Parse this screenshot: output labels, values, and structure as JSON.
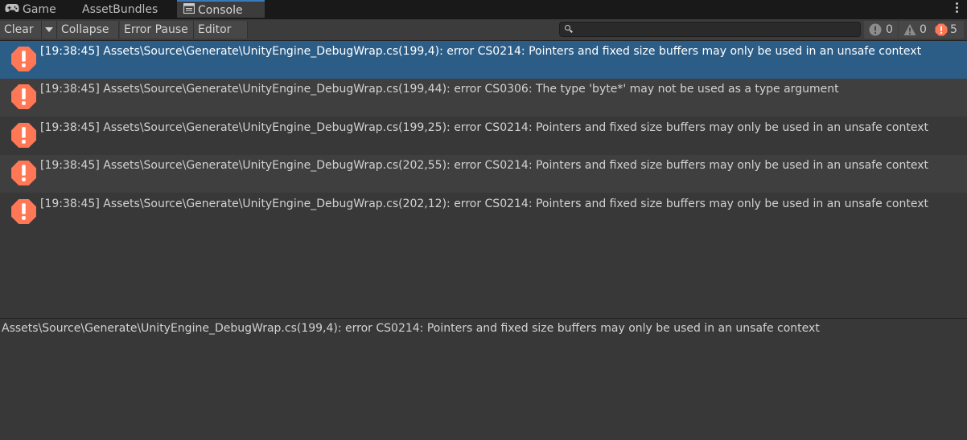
{
  "tabs": [
    {
      "label": "Game",
      "icon": "gamepad-icon"
    },
    {
      "label": "AssetBundles",
      "icon": ""
    },
    {
      "label": "Console",
      "icon": "console-icon"
    }
  ],
  "toolbar": {
    "clear_label": "Clear",
    "collapse_label": "Collapse",
    "error_pause_label": "Error Pause",
    "editor_label": "Editor",
    "search_placeholder": ""
  },
  "counters": {
    "info": "0",
    "warnings": "0",
    "errors": "5"
  },
  "colors": {
    "accent": "#2c5d87",
    "error": "#ff7755",
    "tab_highlight": "#3a79bb"
  },
  "logs": [
    {
      "text": "[19:38:45] Assets\\Source\\Generate\\UnityEngine_DebugWrap.cs(199,4): error CS0214: Pointers and fixed size buffers may only be used in an unsafe context",
      "selected": true
    },
    {
      "text": "[19:38:45] Assets\\Source\\Generate\\UnityEngine_DebugWrap.cs(199,44): error CS0306: The type 'byte*' may not be used as a type argument",
      "selected": false
    },
    {
      "text": "[19:38:45] Assets\\Source\\Generate\\UnityEngine_DebugWrap.cs(199,25): error CS0214: Pointers and fixed size buffers may only be used in an unsafe context",
      "selected": false
    },
    {
      "text": "[19:38:45] Assets\\Source\\Generate\\UnityEngine_DebugWrap.cs(202,55): error CS0214: Pointers and fixed size buffers may only be used in an unsafe context",
      "selected": false
    },
    {
      "text": "[19:38:45] Assets\\Source\\Generate\\UnityEngine_DebugWrap.cs(202,12): error CS0214: Pointers and fixed size buffers may only be used in an unsafe context",
      "selected": false
    }
  ],
  "details": {
    "text": "Assets\\Source\\Generate\\UnityEngine_DebugWrap.cs(199,4): error CS0214: Pointers and fixed size buffers may only be used in an unsafe context"
  }
}
